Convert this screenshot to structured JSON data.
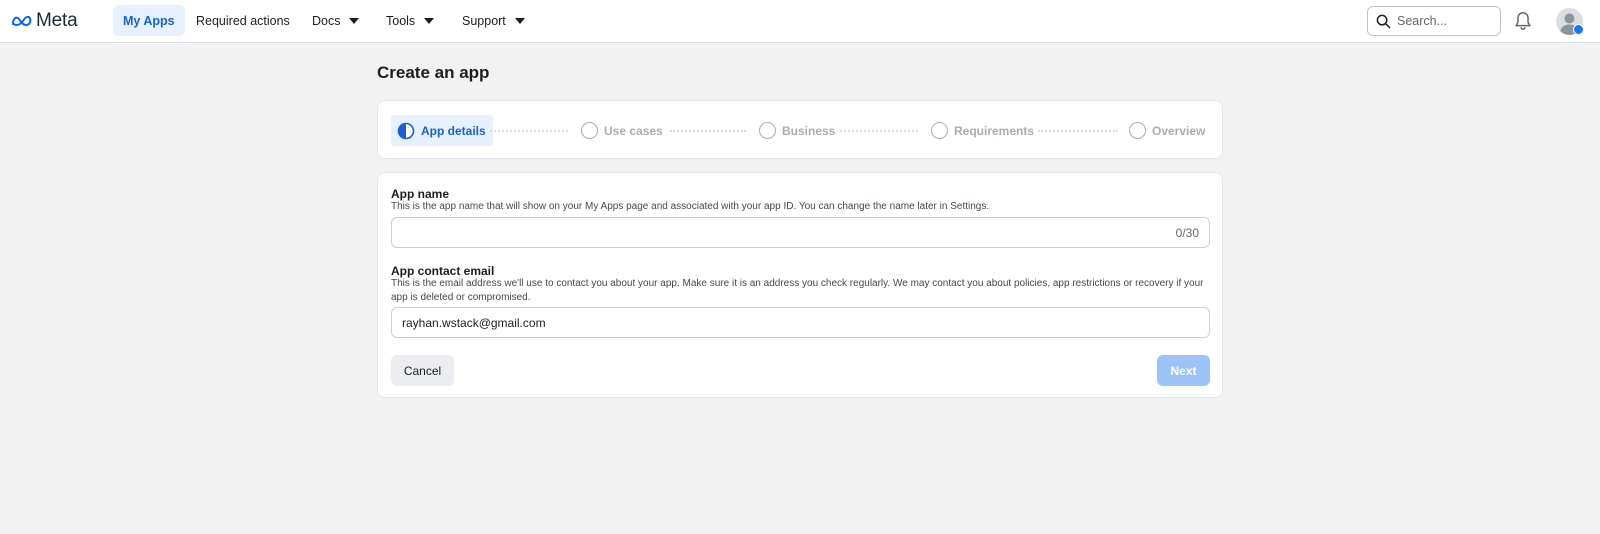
{
  "nav": {
    "logo_text": "Meta",
    "items": [
      {
        "label": "My Apps",
        "active": true
      },
      {
        "label": "Required actions",
        "active": false
      },
      {
        "label": "Docs",
        "has_caret": true
      },
      {
        "label": "Tools",
        "has_caret": true
      },
      {
        "label": "Support",
        "has_caret": true
      }
    ],
    "search_placeholder": "Search...",
    "icons": [
      "search-icon",
      "bell-icon",
      "avatar"
    ]
  },
  "page": {
    "title": "Create an app"
  },
  "stepper": {
    "steps": [
      {
        "label": "App details",
        "state": "current"
      },
      {
        "label": "Use cases",
        "state": "upcoming"
      },
      {
        "label": "Business",
        "state": "upcoming"
      },
      {
        "label": "Requirements",
        "state": "upcoming"
      },
      {
        "label": "Overview",
        "state": "upcoming"
      }
    ]
  },
  "form": {
    "app_name": {
      "label": "App name",
      "description": "This is the app name that will show on your My Apps page and associated with your app ID. You can change the name later in Settings.",
      "value": "",
      "counter": "0/30"
    },
    "contact_email": {
      "label": "App contact email",
      "description": "This is the email address we'll use to contact you about your app. Make sure it is an address you check regularly. We may contact you about policies, app restrictions or recovery if your app is deleted or compromised.",
      "value": "rayhan.wstack@gmail.com"
    },
    "cancel_label": "Cancel",
    "next_label": "Next"
  },
  "colors": {
    "accent": "#1b61d2",
    "accent_bg": "#e7f0fd",
    "next_disabled": "#9cc3f7",
    "page_bg": "#f2f2f2"
  }
}
